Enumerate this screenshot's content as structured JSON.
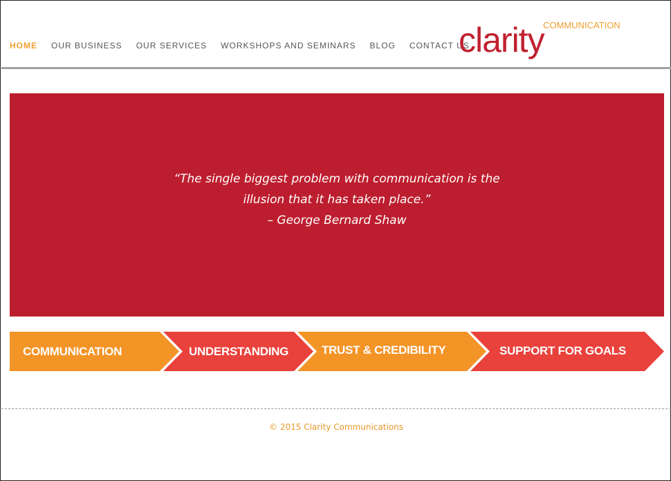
{
  "nav": {
    "items": [
      {
        "label": "HOME",
        "active": true
      },
      {
        "label": "OUR BUSINESS"
      },
      {
        "label": "OUR SERVICES"
      },
      {
        "label": "WORKSHOPS AND SEMINARS"
      },
      {
        "label": "BLOG"
      },
      {
        "label": "CONTACT US"
      }
    ]
  },
  "logo": {
    "word": "clarity",
    "tagline": "COMMUNICATION",
    "colors": {
      "word": "#c0202f",
      "tagline": "#f0a030"
    }
  },
  "banner": {
    "quote_line1": "“The single biggest problem with communication is the",
    "quote_line2": "illusion that it has taken place.”",
    "attribution": "– George Bernard Shaw",
    "color": "#bd1e2f"
  },
  "steps": [
    {
      "label": "COMMUNICATION",
      "color": "#f39426"
    },
    {
      "label": "UNDERSTANDING",
      "color": "#e9413b"
    },
    {
      "label": "TRUST & CREDIBILITY",
      "color": "#f39426"
    },
    {
      "label": "SUPPORT FOR GOALS",
      "color": "#e9413b"
    }
  ],
  "footer": {
    "copyright": "© 2015 Clarity Communications"
  }
}
